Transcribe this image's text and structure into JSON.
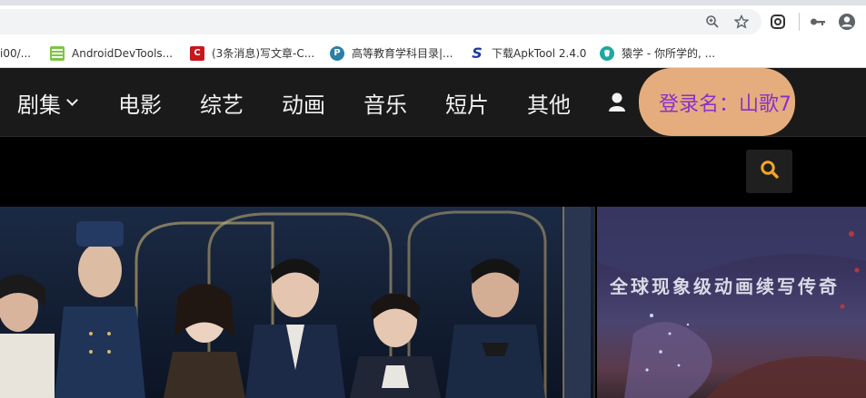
{
  "browser": {
    "toolbar_icons": [
      "zoom-icon",
      "bookmark-star-icon",
      "extension-icon",
      "key-icon",
      "account-icon"
    ],
    "bookmarks": [
      {
        "label": "i00/...",
        "icon": "folder-icon"
      },
      {
        "label": "AndroidDevTools...",
        "icon": "androiddevtools-favicon",
        "color": "#7cc644"
      },
      {
        "label": "(3条消息)写文章-C...",
        "icon": "csdn-favicon",
        "color": "#c9161d"
      },
      {
        "label": "高等教育学科目录|...",
        "icon": "p-favicon",
        "color": "#2b7fa8"
      },
      {
        "label": "下载ApkTool 2.4.0",
        "icon": "s-favicon",
        "color": "#1a3aa0"
      },
      {
        "label": "猿学 - 你所学的, ...",
        "icon": "yuanxue-favicon",
        "color": "#1fa8a0"
      }
    ]
  },
  "site_nav": {
    "items": [
      {
        "label": "剧集",
        "has_dropdown": true
      },
      {
        "label": "电影"
      },
      {
        "label": "综艺"
      },
      {
        "label": "动画"
      },
      {
        "label": "音乐"
      },
      {
        "label": "短片"
      },
      {
        "label": "其他"
      }
    ],
    "user_icon": "user-icon",
    "login_text": "登录名：山歌7",
    "login_bg": "#e5ad7d",
    "login_color": "#8b2fc9"
  },
  "search": {
    "icon": "search-icon",
    "icon_color": "#f5a623"
  },
  "banners": {
    "right_caption": "全球现象级动画续写传奇"
  }
}
